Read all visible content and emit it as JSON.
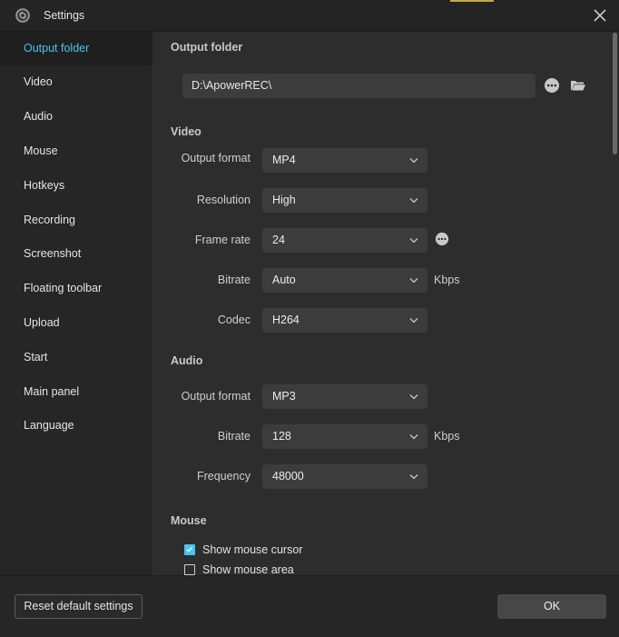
{
  "window": {
    "title": "Settings"
  },
  "icons": {
    "app": "gear-icon",
    "close": "close-icon",
    "more": "more-dots-icon",
    "folder": "folder-open-icon",
    "dropdown": "chevron-down-icon",
    "check": "checkmark-icon"
  },
  "colors": {
    "accent": "#4cc3ea",
    "background": "#2b2b2b",
    "sidebar": "#262626",
    "field": "#3c3c3c"
  },
  "sidebar": {
    "items": [
      {
        "label": "Output folder",
        "active": true
      },
      {
        "label": "Video"
      },
      {
        "label": "Audio"
      },
      {
        "label": "Mouse"
      },
      {
        "label": "Hotkeys"
      },
      {
        "label": "Recording"
      },
      {
        "label": "Screenshot"
      },
      {
        "label": "Floating toolbar"
      },
      {
        "label": "Upload"
      },
      {
        "label": "Start"
      },
      {
        "label": "Main panel"
      },
      {
        "label": "Language"
      }
    ]
  },
  "output_folder": {
    "heading": "Output folder",
    "path": "D:\\ApowerREC\\"
  },
  "video": {
    "heading": "Video",
    "output_format": {
      "label": "Output format",
      "value": "MP4"
    },
    "resolution": {
      "label": "Resolution",
      "value": "High"
    },
    "frame_rate": {
      "label": "Frame rate",
      "value": "24"
    },
    "bitrate": {
      "label": "Bitrate",
      "value": "Auto",
      "unit": "Kbps"
    },
    "codec": {
      "label": "Codec",
      "value": "H264"
    }
  },
  "audio": {
    "heading": "Audio",
    "output_format": {
      "label": "Output format",
      "value": "MP3"
    },
    "bitrate": {
      "label": "Bitrate",
      "value": "128",
      "unit": "Kbps"
    },
    "frequency": {
      "label": "Frequency",
      "value": "48000"
    }
  },
  "mouse": {
    "heading": "Mouse",
    "show_cursor": {
      "label": "Show mouse cursor",
      "checked": true
    },
    "show_area": {
      "label": "Show mouse area",
      "checked": false
    }
  },
  "footer": {
    "reset_label": "Reset default settings",
    "ok_label": "OK"
  }
}
